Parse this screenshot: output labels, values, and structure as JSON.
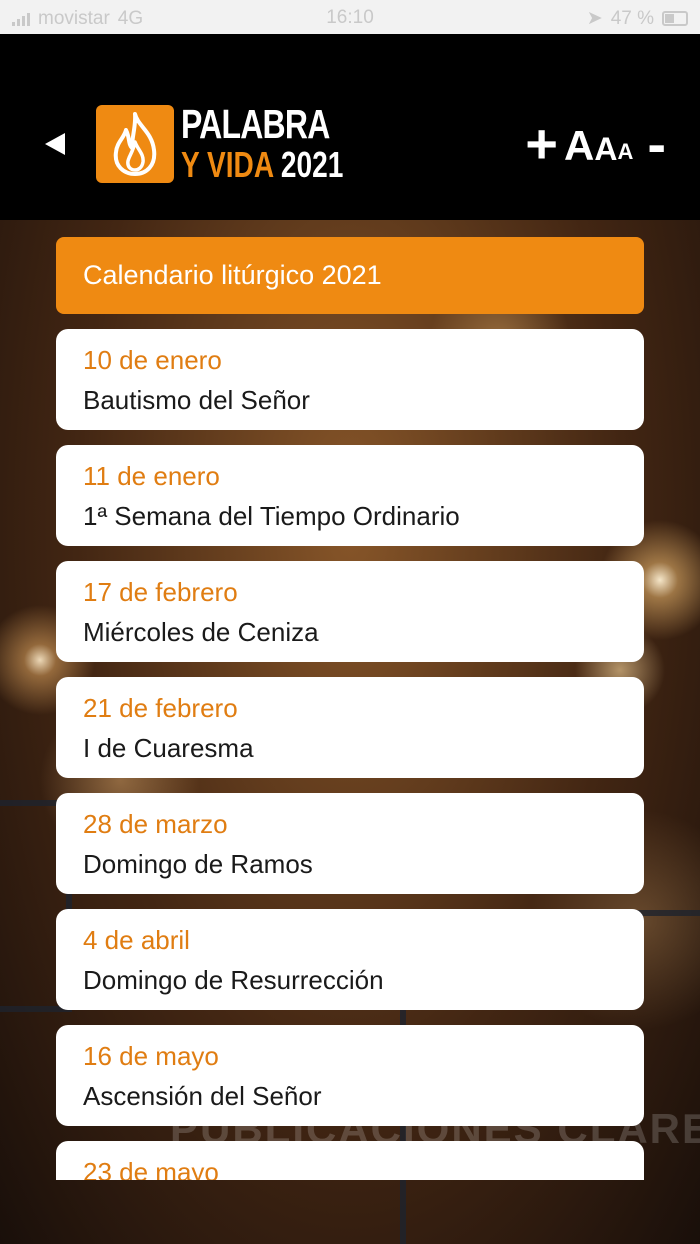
{
  "status_bar": {
    "carrier": "movistar",
    "network": "4G",
    "time": "16:10",
    "battery": "47 %"
  },
  "header": {
    "logo": {
      "line1": "PALABRA",
      "line2_word": "Y VIDA",
      "line2_year": "2021"
    },
    "font_controls": {
      "plus": "+",
      "a_large": "A",
      "a_medium": "A",
      "a_small": "A",
      "minus": "-"
    }
  },
  "background": {
    "watermark": "PUBLICACIONES CLARETIANAS"
  },
  "calendar": {
    "title": "Calendario litúrgico 2021",
    "items": [
      {
        "date": "10 de enero",
        "name": "Bautismo del Señor"
      },
      {
        "date": "11 de enero",
        "name": "1ª Semana del Tiempo Ordinario"
      },
      {
        "date": "17 de febrero",
        "name": "Miércoles de Ceniza"
      },
      {
        "date": "21 de febrero",
        "name": "I de Cuaresma"
      },
      {
        "date": "28 de marzo",
        "name": "Domingo de Ramos"
      },
      {
        "date": "4 de abril",
        "name": "Domingo de Resurrección"
      },
      {
        "date": "16 de mayo",
        "name": "Ascensión del Señor"
      },
      {
        "date": "23 de mayo",
        "name": ""
      }
    ]
  },
  "colors": {
    "accent": "#ef8a12",
    "date_text": "#e07d12",
    "header_bg": "#000000",
    "card_bg": "#ffffff"
  },
  "icons": {
    "back": "back-arrow-icon",
    "logo": "flame-icon",
    "battery": "battery-icon",
    "signal": "signal-icon"
  }
}
